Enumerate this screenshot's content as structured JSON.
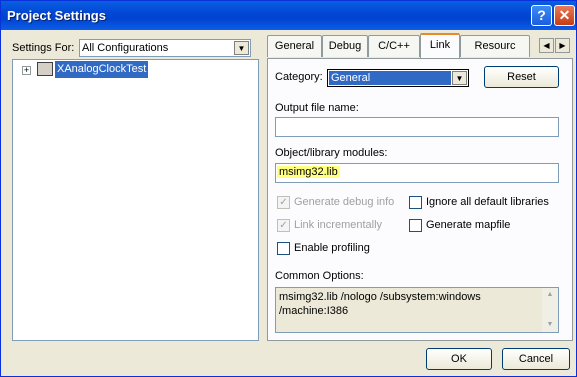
{
  "window": {
    "title": "Project Settings",
    "help": "?",
    "close": "✕"
  },
  "settings_for": {
    "label": "Settings For:",
    "value": "All Configurations"
  },
  "tree": {
    "expander": "+",
    "item": "XAnalogClockTest"
  },
  "tabs": [
    "General",
    "Debug",
    "C/C++",
    "Link",
    "Resourc"
  ],
  "tab_scroll": {
    "left": "◀",
    "right": "▶"
  },
  "category": {
    "label": "Category:",
    "value": "General"
  },
  "reset_label": "Reset",
  "output_file": {
    "label": "Output file name:",
    "value": ""
  },
  "modules": {
    "label": "Object/library modules:",
    "value": "msimg32.lib"
  },
  "checkboxes": [
    {
      "label": "Generate debug info",
      "checked": true
    },
    {
      "label": "Ignore all default libraries",
      "checked": false
    },
    {
      "label": "Link incrementally",
      "checked": true
    },
    {
      "label": "Generate mapfile",
      "checked": false
    },
    {
      "label": "Enable profiling",
      "checked": false
    }
  ],
  "common_options": {
    "label": "Common Options:",
    "line1": "msimg32.lib /nologo /subsystem:windows",
    "line2": "/machine:I386"
  },
  "buttons": {
    "ok": "OK",
    "cancel": "Cancel"
  }
}
